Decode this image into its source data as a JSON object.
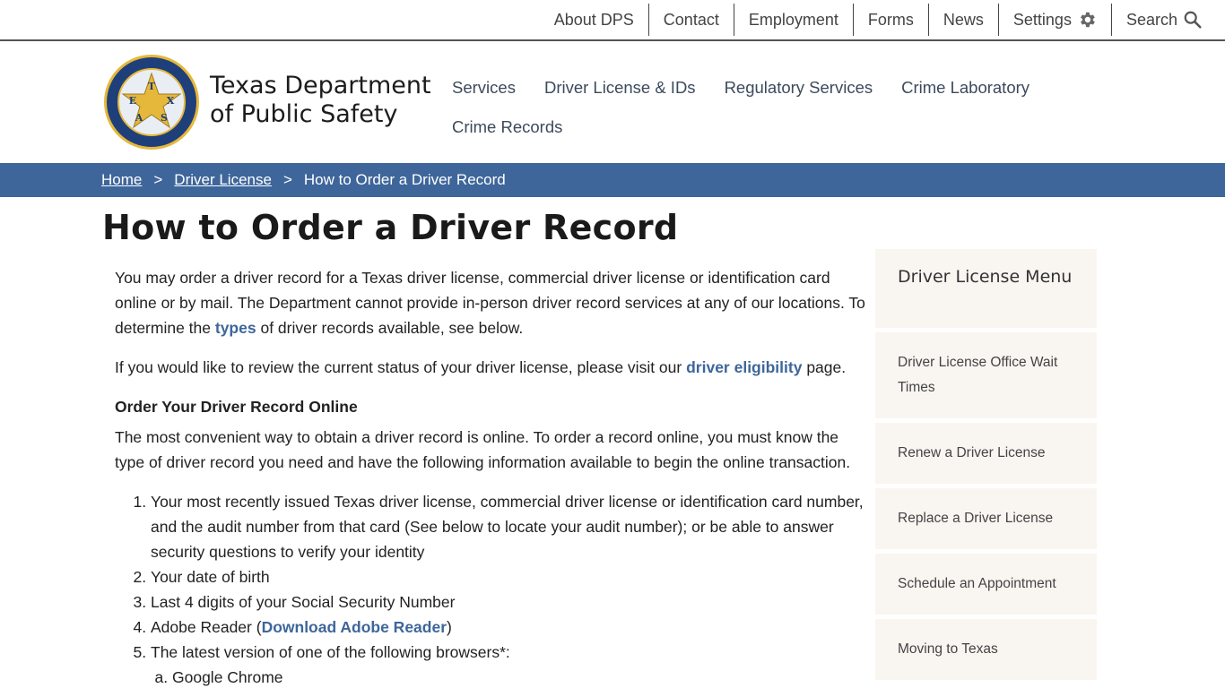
{
  "utility": {
    "links": [
      "About DPS",
      "Contact",
      "Employment",
      "Forms",
      "News"
    ],
    "settings": "Settings",
    "search": "Search"
  },
  "header": {
    "agency_line1": "Texas Department",
    "agency_line2": "of Public Safety",
    "seal_letters": [
      "T",
      "E",
      "X",
      "A",
      "S"
    ],
    "nav": [
      "Services",
      "Driver License & IDs",
      "Regulatory Services",
      "Crime Laboratory",
      "Crime Records"
    ]
  },
  "breadcrumb": {
    "home": "Home",
    "sep": ">",
    "section": "Driver License",
    "current": "How to Order a Driver Record"
  },
  "page_title": "How to Order a Driver Record",
  "content": {
    "p1_a": "You may order a driver record for a Texas driver license, commercial driver license or identification card online or by mail.  The Department cannot provide in-person driver record services at any of our locations. To determine the ",
    "p1_link": "types",
    "p1_b": " of driver records available, see below.",
    "p2_a": "If you would like to review the current status of your driver license, please visit our ",
    "p2_link": "driver eligibility",
    "p2_b": " page.",
    "h_online": "Order Your Driver Record Online",
    "p3": "The most convenient way to obtain a driver record is online.  To order a record online, you must know the type of driver record you need and have the following information available to begin the online transaction.",
    "list": [
      "Your most recently issued Texas driver license, commercial driver license or identification card number, and the audit number from that card (See below to locate your audit number); or be able to answer security questions to verify your identity",
      "Your date of birth",
      "Last 4 digits of your Social Security Number"
    ],
    "li4_a": "Adobe Reader (",
    "li4_link": "Download Adobe Reader",
    "li4_b": ")",
    "li5": "The latest version of one of the following browsers*:",
    "browsers": [
      "Google Chrome"
    ]
  },
  "sidebar": {
    "heading": "Driver License Menu",
    "items": [
      "Driver License Office Wait Times",
      "Renew a Driver License",
      "Replace a Driver License",
      "Schedule an Appointment",
      "Moving to Texas"
    ]
  },
  "colors": {
    "breadcrumb_bg": "#3e669a",
    "link": "#3e669a",
    "sidebar_bg": "#f9f6f2",
    "seal_navy": "#1f3f7a",
    "seal_gold": "#e5b83b"
  }
}
